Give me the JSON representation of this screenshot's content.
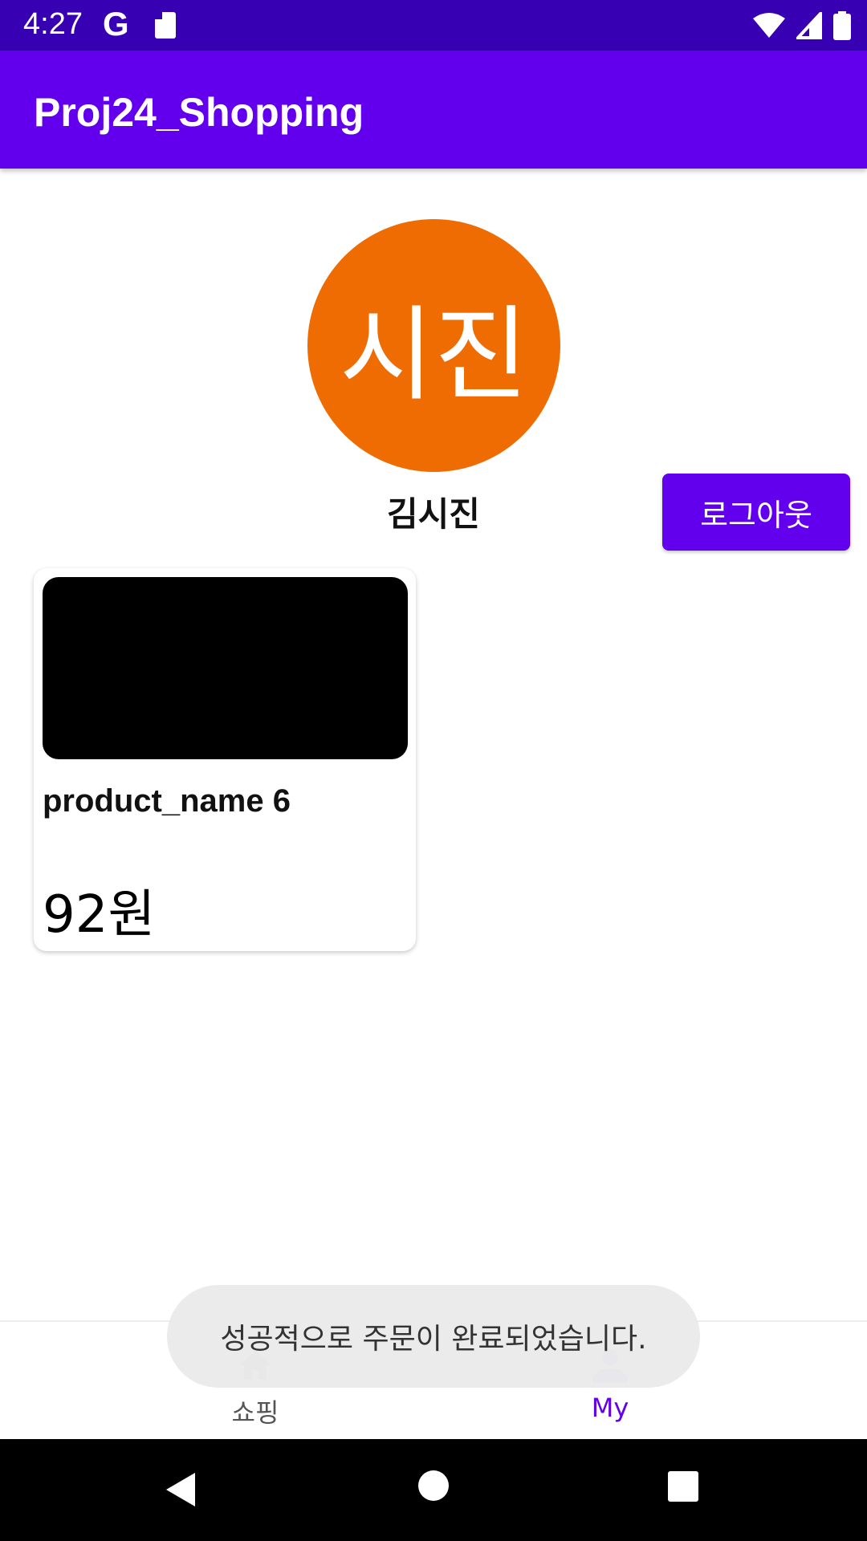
{
  "status_bar": {
    "time": "4:27",
    "google_icon": "G"
  },
  "app_bar": {
    "title": "Proj24_Shopping"
  },
  "profile": {
    "avatar_text": "시진",
    "avatar_color": "#ee6c02",
    "name": "김시진",
    "logout_label": "로그아웃"
  },
  "orders": [
    {
      "name": "product_name 6",
      "price": "92원"
    }
  ],
  "bottom_nav": {
    "items": [
      {
        "label": "쇼핑",
        "icon": "home-icon",
        "active": false
      },
      {
        "label": "My",
        "icon": "person-icon",
        "active": true
      }
    ]
  },
  "toast": {
    "message": "성공적으로 주문이 완료되었습니다."
  },
  "colors": {
    "primary": "#6200ee",
    "primary_dark": "#3700b3",
    "active_nav_icon": "#c4a7f2"
  }
}
